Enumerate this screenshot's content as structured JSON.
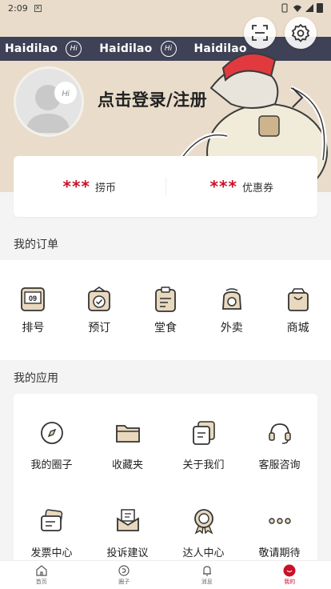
{
  "status_bar": {
    "time": "2:09"
  },
  "header": {
    "brand_words": [
      "Haidilao",
      "Haidilao",
      "Haidilao"
    ],
    "login_text": "点击登录/注册"
  },
  "stats": [
    {
      "value": "***",
      "label": "捞币"
    },
    {
      "value": "***",
      "label": "优惠券"
    }
  ],
  "orders": {
    "title": "我的订单",
    "items": [
      {
        "label": "排号",
        "icon": "queue-number-icon",
        "badge": "09"
      },
      {
        "label": "预订",
        "icon": "reservation-icon"
      },
      {
        "label": "堂食",
        "icon": "dine-in-icon"
      },
      {
        "label": "外卖",
        "icon": "delivery-icon"
      },
      {
        "label": "商城",
        "icon": "shop-bag-icon"
      }
    ]
  },
  "apps": {
    "title": "我的应用",
    "items": [
      {
        "label": "我的圈子",
        "icon": "compass-icon"
      },
      {
        "label": "收藏夹",
        "icon": "folder-icon"
      },
      {
        "label": "关于我们",
        "icon": "about-cards-icon"
      },
      {
        "label": "客服咨询",
        "icon": "headset-icon"
      },
      {
        "label": "发票中心",
        "icon": "invoice-icon"
      },
      {
        "label": "投诉建议",
        "icon": "complaint-mail-icon"
      },
      {
        "label": "达人中心",
        "icon": "badge-award-icon"
      },
      {
        "label": "敬请期待",
        "icon": "more-dots-icon"
      }
    ]
  },
  "tabbar": {
    "items": [
      {
        "label": "首页",
        "icon": "home-icon"
      },
      {
        "label": "圈子",
        "icon": "circle-icon"
      },
      {
        "label": "消息",
        "icon": "bell-icon"
      },
      {
        "label": "我的",
        "icon": "profile-icon",
        "active": true
      }
    ]
  },
  "colors": {
    "accent": "#c9112a",
    "brand_band": "#3f4256",
    "header_bg": "#e9dccb"
  }
}
